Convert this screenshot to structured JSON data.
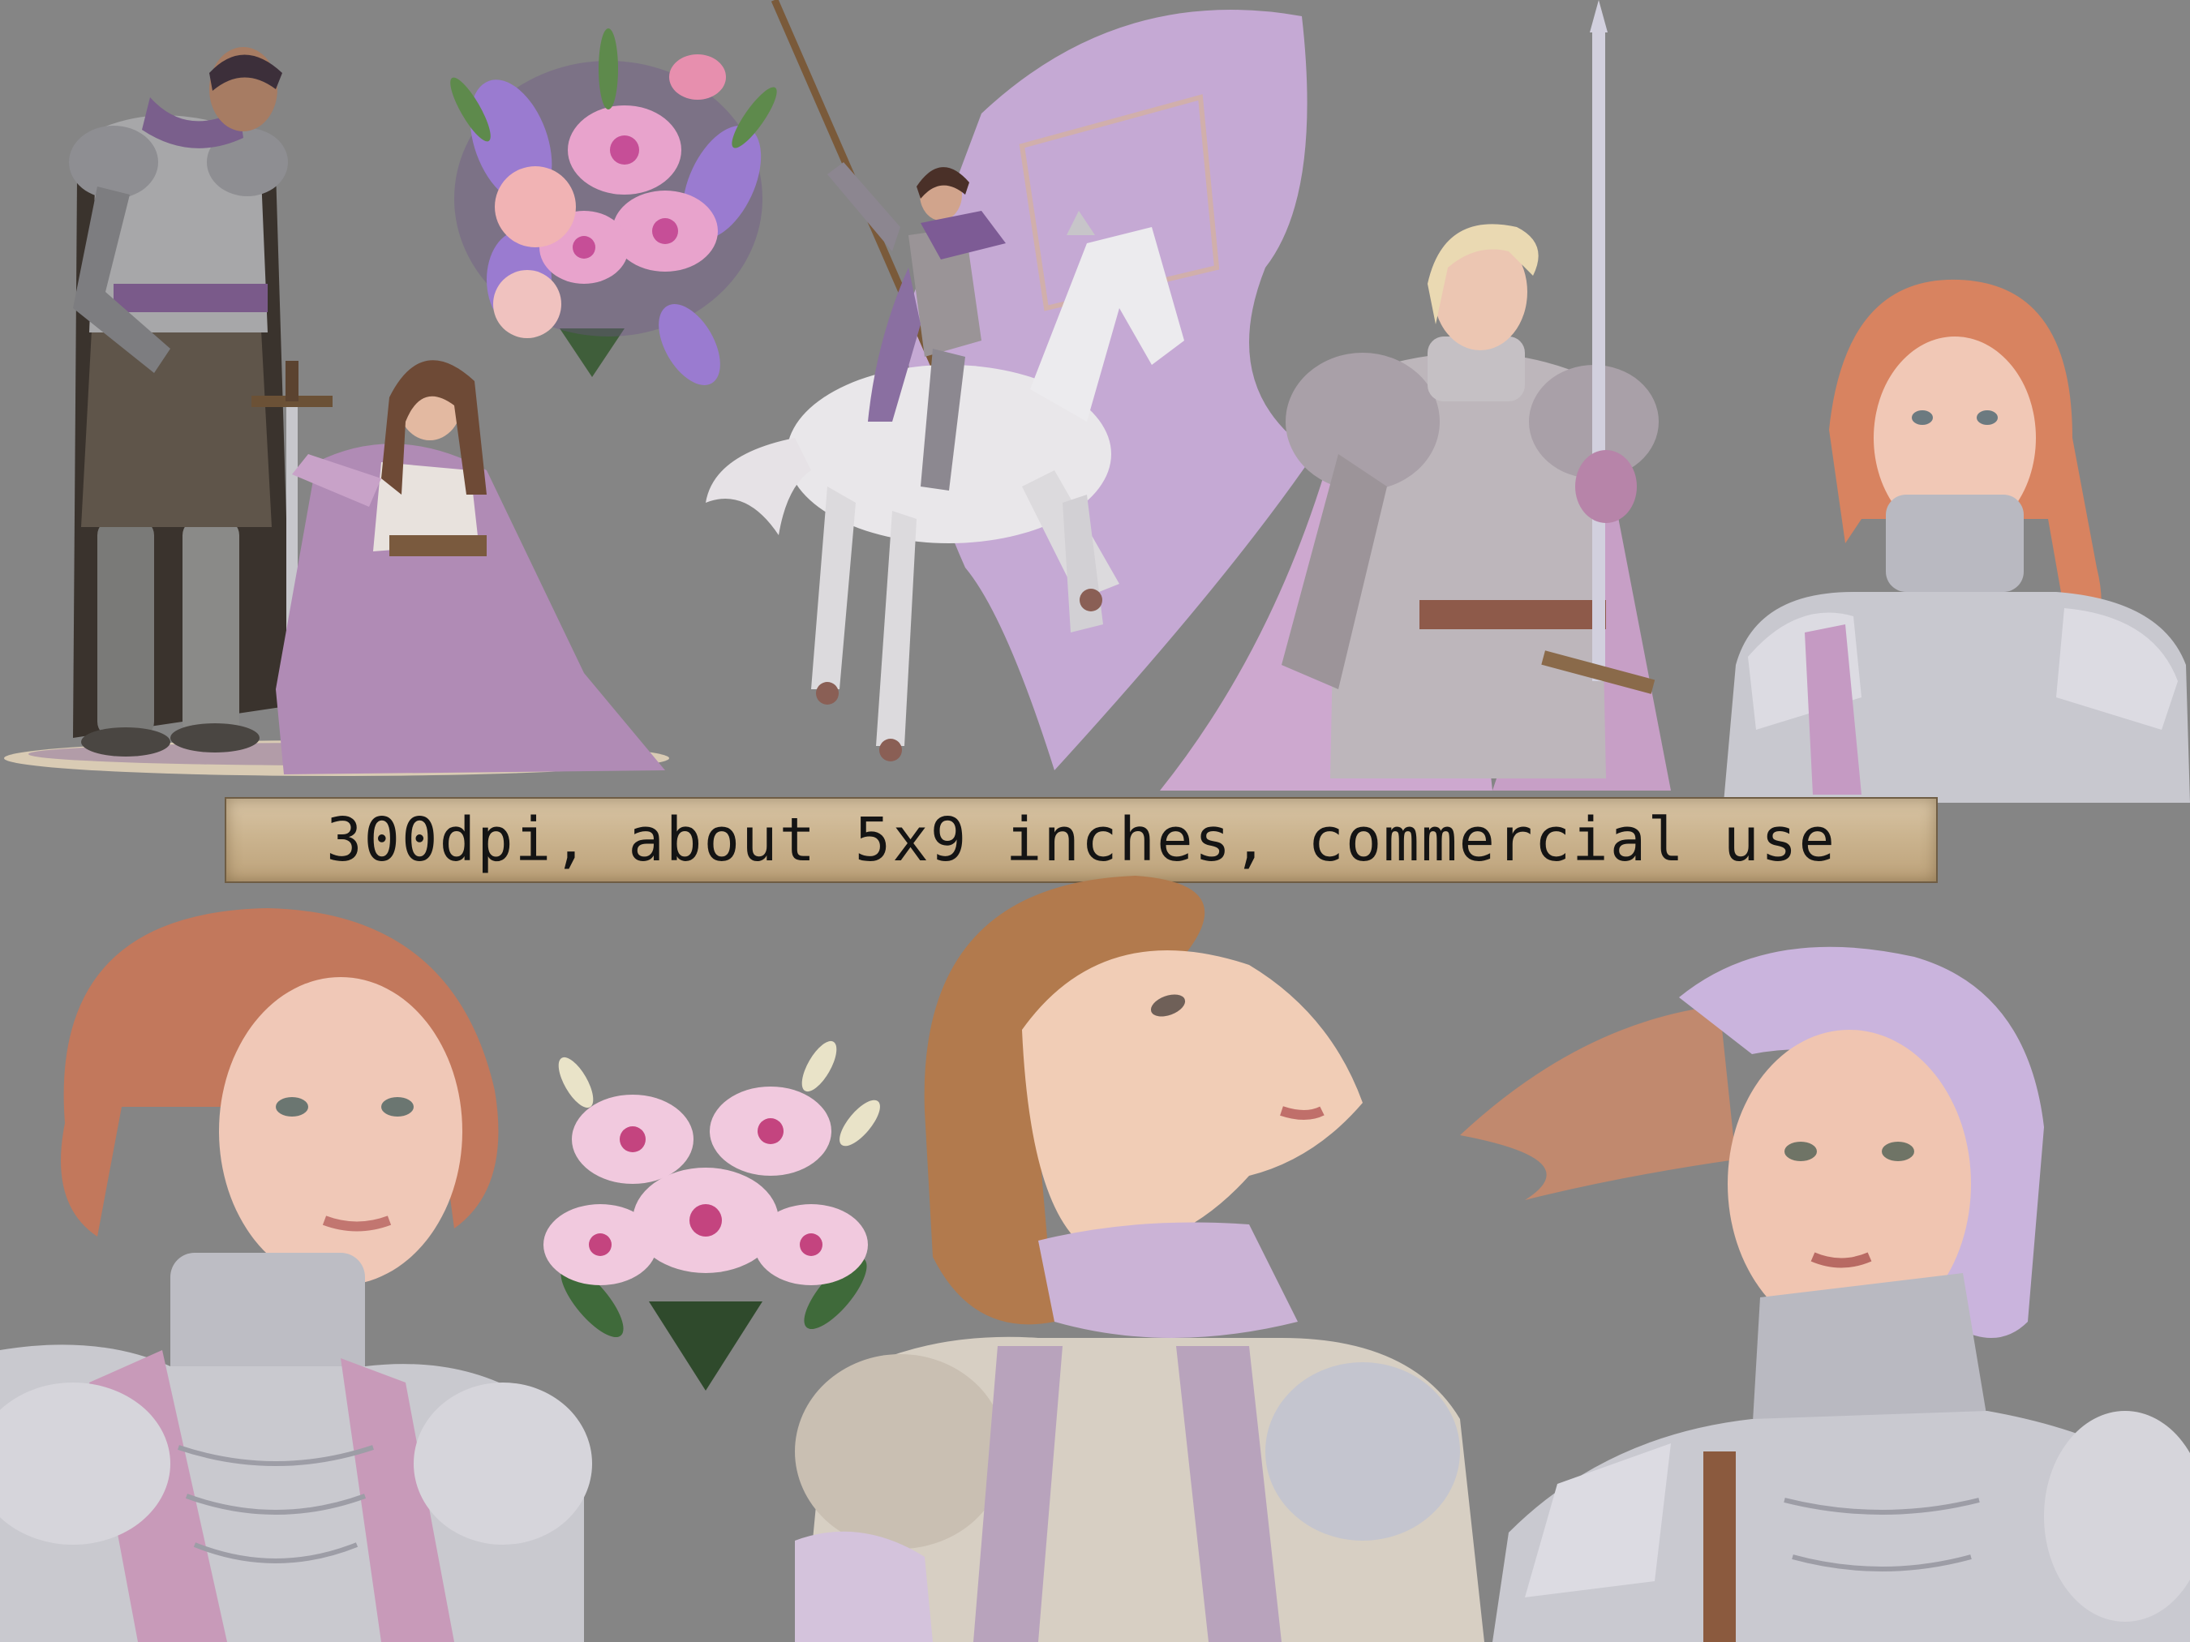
{
  "banner": {
    "text": "300dpi, about 5x9 inches, commercial use"
  },
  "colors": {
    "background": "#858585",
    "lavender": "#b89ac9",
    "armor": "#c9c9cf",
    "pink_lily": "#d98fbf",
    "parchment": "#cbb48f"
  },
  "clips": [
    {
      "name": "knight-and-kneeling-woman"
    },
    {
      "name": "lily-bouquet-purple"
    },
    {
      "name": "rider-on-white-horse-with-banner"
    },
    {
      "name": "blonde-knight-with-sword"
    },
    {
      "name": "redhead-girl-in-armor"
    },
    {
      "name": "short-haired-woman-in-armor"
    },
    {
      "name": "pink-lily-bouquet"
    },
    {
      "name": "woman-looking-up"
    },
    {
      "name": "girl-in-lavender-hood"
    }
  ]
}
